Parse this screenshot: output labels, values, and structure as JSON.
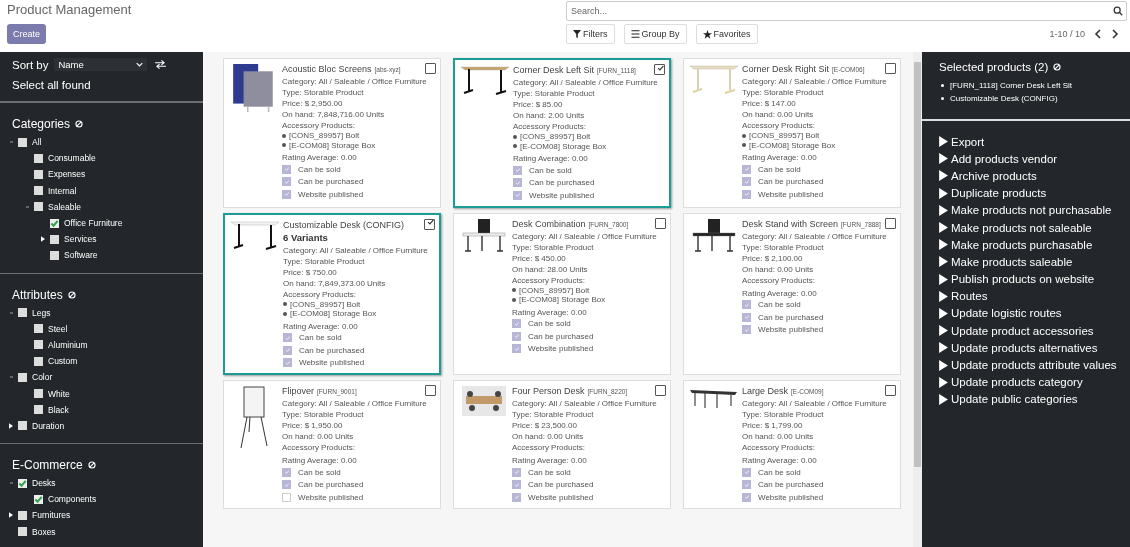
{
  "header": {
    "title": "Product Management",
    "create_button": "Create",
    "search": {
      "placeholder": "Search..."
    },
    "filter_buttons": [
      "Filters",
      "Group By",
      "Favorites"
    ],
    "pager": "1-10 / 10"
  },
  "sidebar": {
    "sort_label": "Sort by",
    "sort_value": "Name",
    "select_all": "Select all found",
    "sections": [
      {
        "title": "Categories",
        "items": [
          {
            "label": "All",
            "checked": false,
            "expanded": true,
            "children": [
              {
                "label": "Consumable",
                "checked": false
              },
              {
                "label": "Expenses",
                "checked": false
              },
              {
                "label": "Internal",
                "checked": false
              },
              {
                "label": "Saleable",
                "checked": false,
                "expanded": true,
                "children": [
                  {
                    "label": "Office Furniture",
                    "checked": true
                  },
                  {
                    "label": "Services",
                    "checked": false,
                    "expanded": false
                  },
                  {
                    "label": "Software",
                    "checked": false
                  }
                ]
              }
            ]
          }
        ]
      },
      {
        "title": "Attributes",
        "items": [
          {
            "label": "Legs",
            "checked": false,
            "expanded": true,
            "children": [
              {
                "label": "Steel",
                "checked": false
              },
              {
                "label": "Aluminium",
                "checked": false
              },
              {
                "label": "Custom",
                "checked": false
              }
            ]
          },
          {
            "label": "Color",
            "checked": false,
            "expanded": true,
            "children": [
              {
                "label": "White",
                "checked": false
              },
              {
                "label": "Black",
                "checked": false
              }
            ]
          },
          {
            "label": "Duration",
            "checked": false,
            "expanded": false
          }
        ]
      },
      {
        "title": "E-Commerce",
        "items": [
          {
            "label": "Desks",
            "checked": true,
            "expanded": true,
            "children": [
              {
                "label": "Components",
                "checked": true
              }
            ]
          },
          {
            "label": "Furnitures",
            "checked": false,
            "expanded": false
          },
          {
            "label": "Boxes",
            "checked": false
          }
        ]
      }
    ]
  },
  "products": [
    {
      "name": "Acoustic Bloc Screens",
      "code": "[abs-xyz]",
      "selected": false,
      "category": "Category: All / Saleable / Office Furniture",
      "type": "Type: Storable Product",
      "price": "Price: $ 2,950.00",
      "on_hand": "On hand: 7,848,716.00 Units",
      "accessories_label": "Accessory Products:",
      "accessories": [
        "[CONS_89957] Bolt",
        "[E-COM08] Storage Box"
      ],
      "rating": "Rating Average: 0.00",
      "flags": [
        {
          "label": "Can be sold",
          "checked": true
        },
        {
          "label": "Can be purchased",
          "checked": true
        },
        {
          "label": "Website published",
          "checked": true
        }
      ]
    },
    {
      "name": "Corner Desk Left Sit",
      "code": "[FURN_1118]",
      "selected": true,
      "category": "Category: All / Saleable / Office Furniture",
      "type": "Type: Storable Product",
      "price": "Price: $ 85.00",
      "on_hand": "On hand: 2.00 Units",
      "accessories_label": "Accessory Products:",
      "accessories": [
        "[CONS_89957] Bolt",
        "[E-COM08] Storage Box"
      ],
      "rating": "Rating Average: 0.00",
      "flags": [
        {
          "label": "Can be sold",
          "checked": true
        },
        {
          "label": "Can be purchased",
          "checked": true
        },
        {
          "label": "Website published",
          "checked": true
        }
      ]
    },
    {
      "name": "Corner Desk Right Sit",
      "code": "[E-COM06]",
      "selected": false,
      "category": "Category: All / Saleable / Office Furniture",
      "type": "Type: Storable Product",
      "price": "Price: $ 147.00",
      "on_hand": "On hand: 0.00 Units",
      "accessories_label": "Accessory Products:",
      "accessories": [
        "[CONS_89957] Bolt",
        "[E-COM08] Storage Box"
      ],
      "rating": "Rating Average: 0.00",
      "flags": [
        {
          "label": "Can be sold",
          "checked": true
        },
        {
          "label": "Can be purchased",
          "checked": true
        },
        {
          "label": "Website published",
          "checked": true
        }
      ]
    },
    {
      "name": "Customizable Desk (CONFIG)",
      "selected": true,
      "variants": "6 Variants",
      "category": "Category: All / Saleable / Office Furniture",
      "type": "Type: Storable Product",
      "price": "Price: $ 750.00",
      "on_hand": "On hand: 7,849,373.00 Units",
      "accessories_label": "Accessory Products:",
      "accessories": [
        "[CONS_89957] Bolt",
        "[E-COM08] Storage Box"
      ],
      "rating": "Rating Average: 0.00",
      "flags": [
        {
          "label": "Can be sold",
          "checked": true
        },
        {
          "label": "Can be purchased",
          "checked": true
        },
        {
          "label": "Website published",
          "checked": true
        }
      ]
    },
    {
      "name": "Desk Combination",
      "code": "[FURN_7800]",
      "selected": false,
      "category": "Category: All / Saleable / Office Furniture",
      "type": "Type: Storable Product",
      "price": "Price: $ 450.00",
      "on_hand": "On hand: 28.00 Units",
      "accessories_label": "Accessory Products:",
      "accessories": [
        "[CONS_89957] Bolt",
        "[E-COM08] Storage Box"
      ],
      "rating": "Rating Average: 0.00",
      "flags": [
        {
          "label": "Can be sold",
          "checked": true
        },
        {
          "label": "Can be purchased",
          "checked": true
        },
        {
          "label": "Website published",
          "checked": true
        }
      ]
    },
    {
      "name": "Desk Stand with Screen",
      "code": "[FURN_7888]",
      "selected": false,
      "category": "Category: All / Saleable / Office Furniture",
      "type": "Type: Storable Product",
      "price": "Price: $ 2,100.00",
      "on_hand": "On hand: 0.00 Units",
      "accessories_label": "Accessory Products:",
      "rating": "Rating Average: 0.00",
      "flags": [
        {
          "label": "Can be sold",
          "checked": true
        },
        {
          "label": "Can be purchased",
          "checked": true
        },
        {
          "label": "Website published",
          "checked": true
        }
      ]
    },
    {
      "name": "Flipover",
      "code": "[FURN_9001]",
      "selected": false,
      "category": "Category: All / Saleable / Office Furniture",
      "type": "Type: Storable Product",
      "price": "Price: $ 1,950.00",
      "on_hand": "On hand: 0.00 Units",
      "accessories_label": "Accessory Products:",
      "rating": "Rating Average: 0.00",
      "flags": [
        {
          "label": "Can be sold",
          "checked": true
        },
        {
          "label": "Can be purchased",
          "checked": true
        },
        {
          "label": "Website published",
          "checked": false
        }
      ]
    },
    {
      "name": "Four Person Desk",
      "code": "[FURN_8220]",
      "selected": false,
      "category": "Category: All / Saleable / Office Furniture",
      "type": "Type: Storable Product",
      "price": "Price: $ 23,500.00",
      "on_hand": "On hand: 0.00 Units",
      "accessories_label": "Accessory Products:",
      "rating": "Rating Average: 0.00",
      "flags": [
        {
          "label": "Can be sold",
          "checked": true
        },
        {
          "label": "Can be purchased",
          "checked": true
        },
        {
          "label": "Website published",
          "checked": true
        }
      ]
    },
    {
      "name": "Large Desk",
      "code": "[E-COM09]",
      "selected": false,
      "category": "Category: All / Saleable / Office Furniture",
      "type": "Type: Storable Product",
      "price": "Price: $ 1,799.00",
      "on_hand": "On hand: 0.00 Units",
      "accessories_label": "Accessory Products:",
      "rating": "Rating Average: 0.00",
      "flags": [
        {
          "label": "Can be sold",
          "checked": true
        },
        {
          "label": "Can be purchased",
          "checked": true
        },
        {
          "label": "Website published",
          "checked": true
        }
      ]
    }
  ],
  "selection_panel": {
    "title": "Selected products (2)",
    "items": [
      "[FURN_1118] Corner Desk Left Sit",
      "Customizable Desk (CONFIG)"
    ],
    "actions": [
      "Export",
      "Add products vendor",
      "Archive products",
      "Duplicate products",
      "Make products not purchasable",
      "Make products not saleable",
      "Make products purchasable",
      "Make products saleable",
      "Publish products on website",
      "Routes",
      "Update logistic routes",
      "Update product accessories",
      "Update products alternatives",
      "Update products attribute values",
      "Update products category",
      "Update public categories"
    ]
  }
}
